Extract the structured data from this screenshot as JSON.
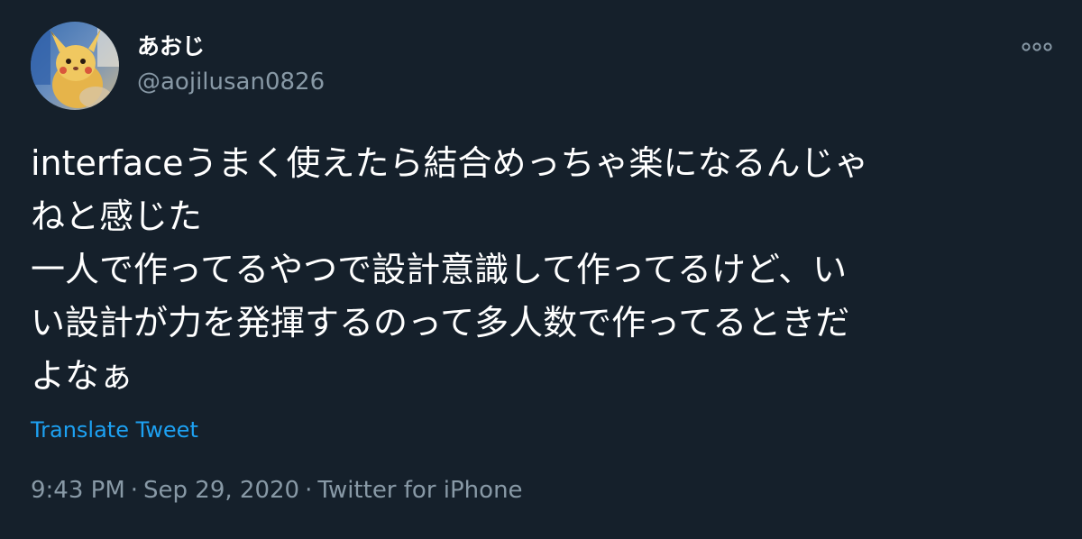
{
  "tweet": {
    "author": {
      "display_name": "あおじ",
      "handle": "@aojilusan0826"
    },
    "text_lines": [
      "interfaceうまく使えたら結合めっちゃ楽になるんじゃ",
      "ねと感じた",
      "一人で作ってるやつで設計意識して作ってるけど、い",
      "い設計が力を発揮するのって多人数で作ってるときだ",
      "よなぁ"
    ],
    "translate_label": "Translate Tweet",
    "time": "9:43 PM",
    "separator": "·",
    "date": "Sep 29, 2020",
    "source": "Twitter for iPhone"
  },
  "icons": {
    "more": "more-horizontal-icon",
    "avatar": "avatar-image"
  },
  "colors": {
    "background": "#15202b",
    "text_primary": "#ffffff",
    "text_secondary": "#8899a6",
    "link": "#1da1f2"
  }
}
